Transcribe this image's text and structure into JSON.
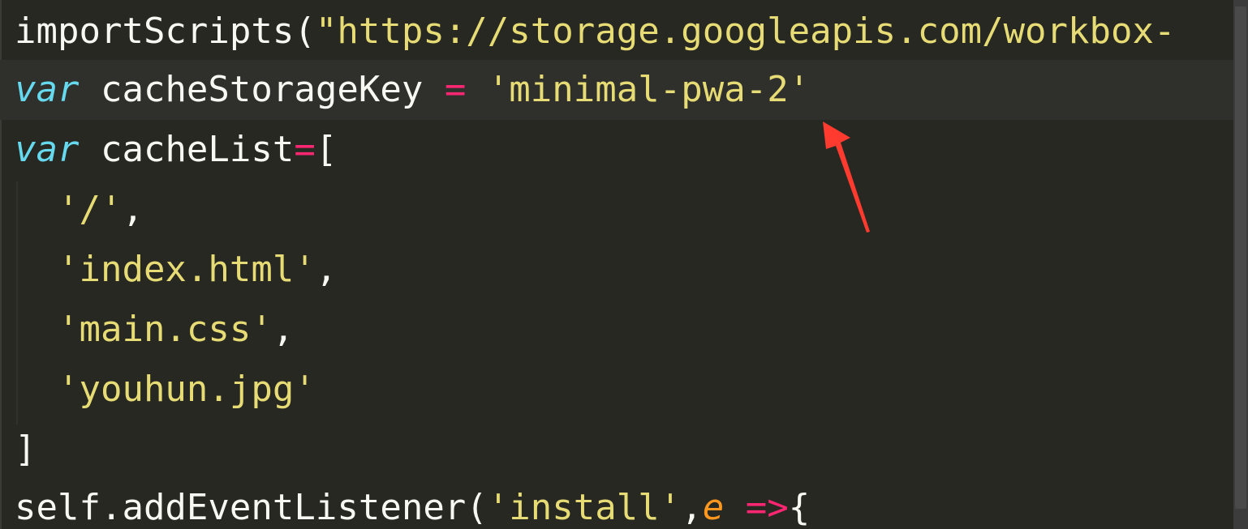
{
  "code": {
    "line1": {
      "fn": "importScripts",
      "open": "(",
      "str": "\"https://storage.googleapis.com/workbox-"
    },
    "line2": {
      "kw": "var",
      "name": " cacheStorageKey ",
      "op": "=",
      "str": " 'minimal-pwa-2'"
    },
    "line3": {
      "kw": "var",
      "name": " cacheList",
      "op": "=",
      "rest": "["
    },
    "line4": {
      "indent": "  ",
      "str": "'/'",
      "rest": ","
    },
    "line5": {
      "indent": "  ",
      "str": "'index.html'",
      "rest": ","
    },
    "line6": {
      "indent": "  ",
      "str": "'main.css'",
      "rest": ","
    },
    "line7": {
      "indent": "  ",
      "str": "'youhun.jpg'"
    },
    "line8": {
      "text": "]"
    },
    "line9": {
      "obj": "self.addEventListener(",
      "str": "'install'",
      "comma": ",",
      "param": "e",
      "arrow": " =>",
      "rest": "{"
    }
  },
  "annotation": {
    "arrow_color": "#ff3b30",
    "target": "minimal-pwa-2"
  },
  "colors": {
    "background": "#272822",
    "keyword": "#66d9ef",
    "operator": "#f92672",
    "string": "#e6db74",
    "parameter": "#fd971f",
    "text": "#f8f8f2"
  }
}
